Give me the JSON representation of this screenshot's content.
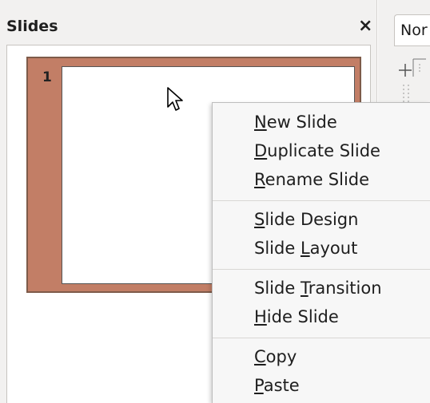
{
  "pane": {
    "title": "Slides",
    "close_glyph": "×"
  },
  "slides": [
    {
      "number": "1"
    }
  ],
  "view_tab": {
    "label": "Nor"
  },
  "context_menu": {
    "items": [
      {
        "pre": "",
        "key": "N",
        "post": "ew Slide"
      },
      {
        "pre": "",
        "key": "D",
        "post": "uplicate Slide"
      },
      {
        "pre": "",
        "key": "R",
        "post": "ename Slide"
      },
      {
        "pre": "",
        "key": "S",
        "post": "lide Design"
      },
      {
        "pre": "Slide ",
        "key": "L",
        "post": "ayout"
      },
      {
        "pre": "Slide ",
        "key": "T",
        "post": "ransition"
      },
      {
        "pre": "",
        "key": "H",
        "post": "ide Slide"
      },
      {
        "pre": "",
        "key": "C",
        "post": "opy"
      },
      {
        "pre": "",
        "key": "P",
        "post": "aste"
      }
    ]
  },
  "colors": {
    "selected_slide_fill": "#c27e66",
    "selected_slide_border": "#7e5b49"
  },
  "icons": [
    "close-icon",
    "mouse-pointer-icon",
    "ruler-corner-icon"
  ]
}
